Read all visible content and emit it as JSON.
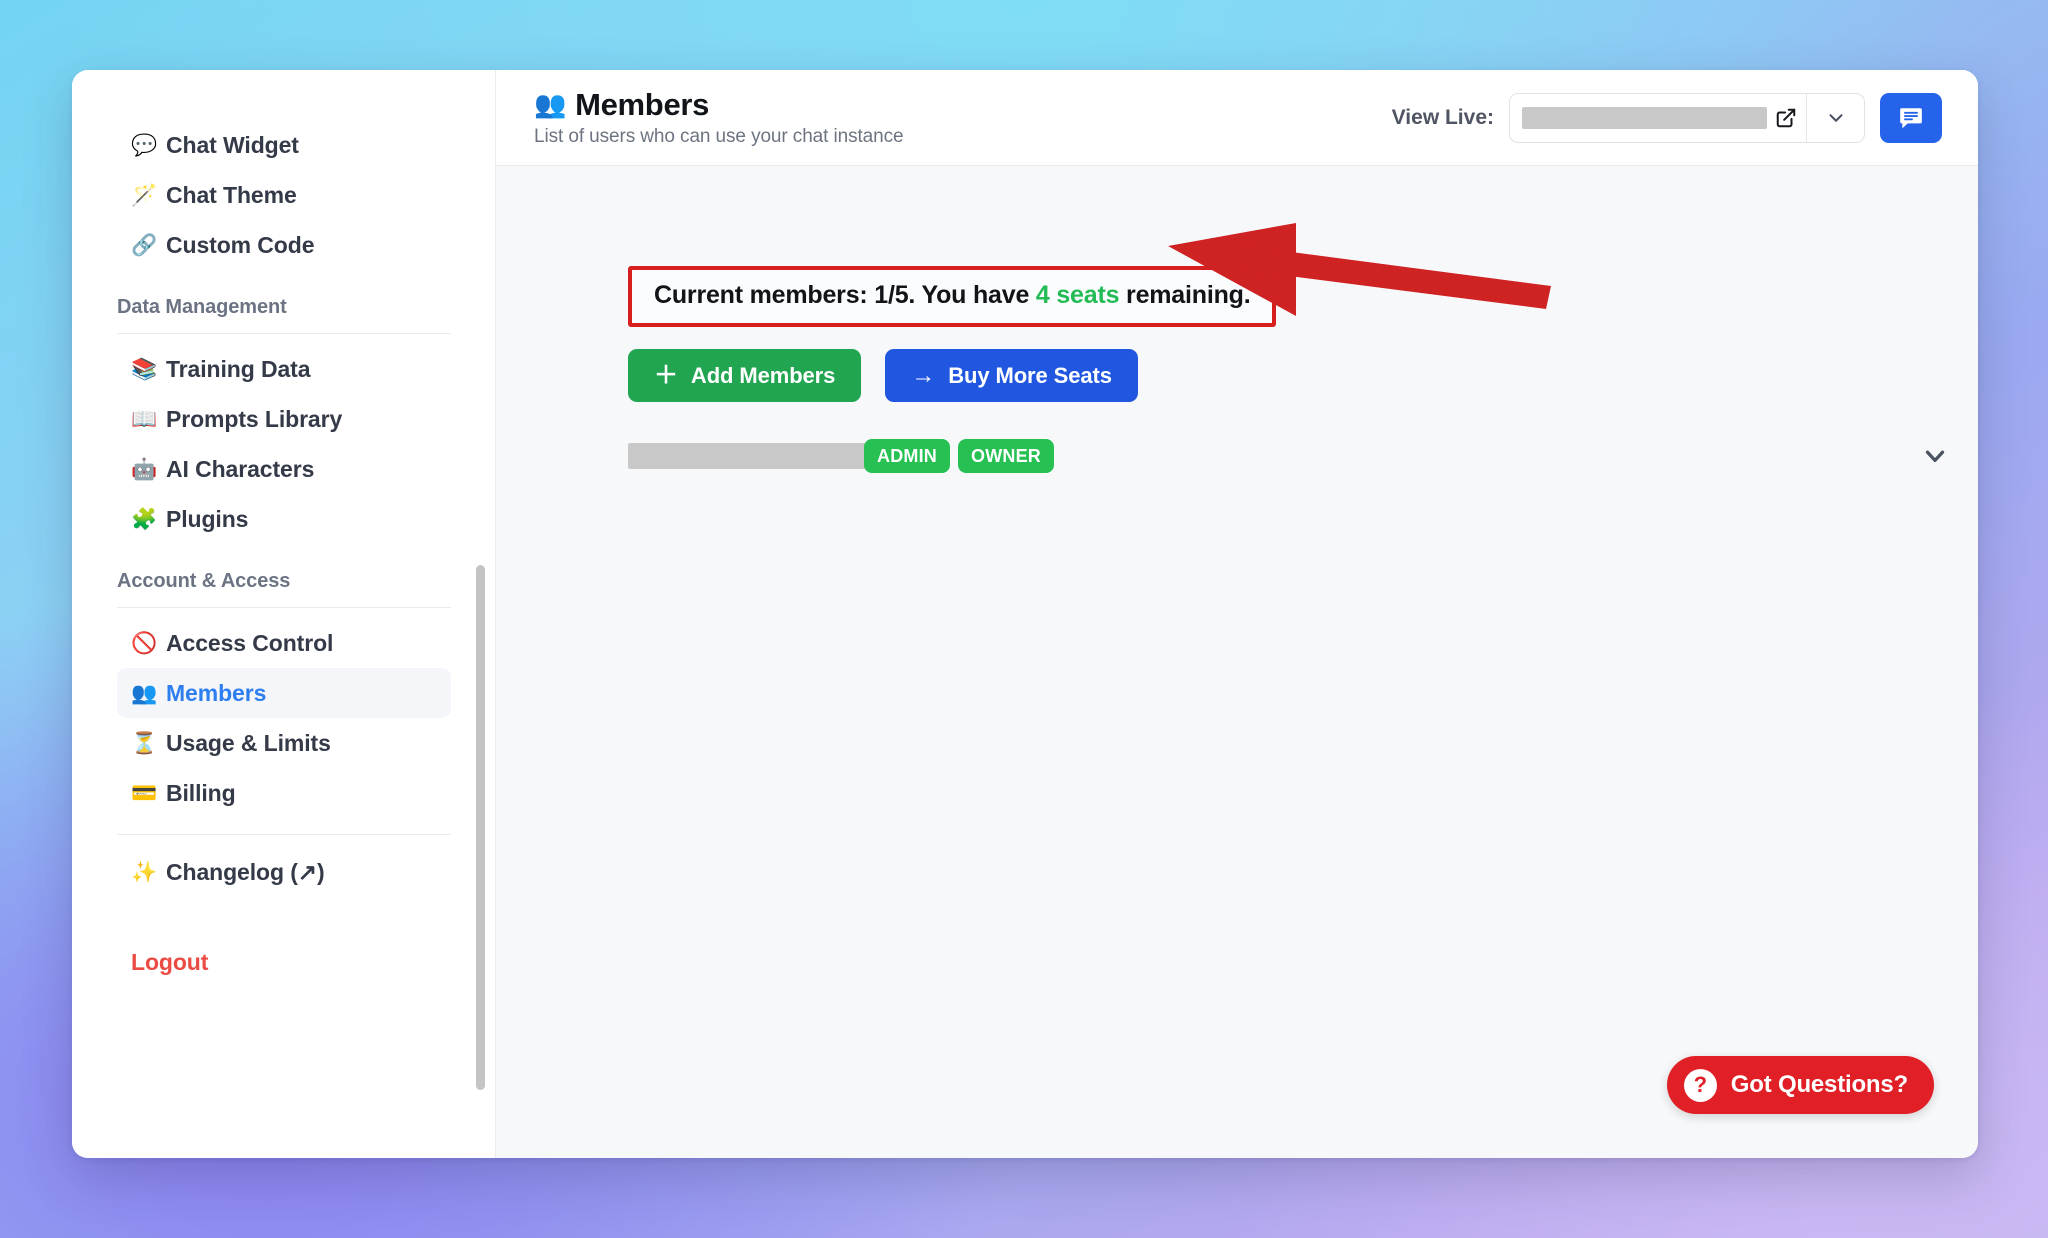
{
  "window": {
    "title": "Members"
  },
  "sidebar": {
    "top_items": [
      {
        "icon": "💬",
        "icon_name": "speech-bubble-icon",
        "label": "Chat Widget"
      },
      {
        "icon": "🪄",
        "icon_name": "magic-wand-icon",
        "label": "Chat Theme"
      },
      {
        "icon": "🔗",
        "icon_name": "link-icon",
        "label": "Custom Code"
      }
    ],
    "groups": [
      {
        "title": "Data Management",
        "items": [
          {
            "icon": "📚",
            "icon_name": "books-icon",
            "label": "Training Data"
          },
          {
            "icon": "📖",
            "icon_name": "open-book-icon",
            "label": "Prompts Library"
          },
          {
            "icon": "🤖",
            "icon_name": "robot-icon",
            "label": "AI Characters"
          },
          {
            "icon": "🧩",
            "icon_name": "puzzle-piece-icon",
            "label": "Plugins"
          }
        ]
      },
      {
        "title": "Account & Access",
        "items": [
          {
            "icon": "🚫",
            "icon_name": "prohibited-icon",
            "label": "Access Control",
            "active": false
          },
          {
            "icon": "👥",
            "icon_name": "people-icon",
            "label": "Members",
            "active": true
          },
          {
            "icon": "⏳",
            "icon_name": "hourglass-icon",
            "label": "Usage & Limits",
            "active": false
          },
          {
            "icon": "💳",
            "icon_name": "credit-card-icon",
            "label": "Billing",
            "active": false
          }
        ]
      }
    ],
    "changelog": {
      "icon": "✨",
      "icon_name": "sparkles-icon",
      "label": "Changelog (↗)"
    },
    "logout_label": "Logout"
  },
  "header": {
    "icon": "👥",
    "title": "Members",
    "subtitle": "List of users who can use your chat instance",
    "view_live_label": "View Live:",
    "url_value": "",
    "url_redacted": true
  },
  "main": {
    "seats_banner": {
      "prefix": "Current members: 1/5. You have ",
      "highlight": "4 seats",
      "suffix": " remaining.",
      "current_members": 1,
      "total_seats": 5,
      "seats_remaining": 4,
      "highlight_color": "#22bb55",
      "border_color": "#d81f1f"
    },
    "buttons": [
      {
        "icon": "＋",
        "label": "Add Members",
        "color": "#22a551"
      },
      {
        "icon": "→",
        "label": "Buy More Seats",
        "color": "#2157e0"
      }
    ],
    "members": [
      {
        "email_redacted": true,
        "email": "",
        "badges": [
          "ADMIN",
          "OWNER"
        ],
        "badge_color": "#26c152"
      }
    ]
  },
  "support": {
    "label": "Got Questions?",
    "icon": "?",
    "color": "#e01f26"
  }
}
